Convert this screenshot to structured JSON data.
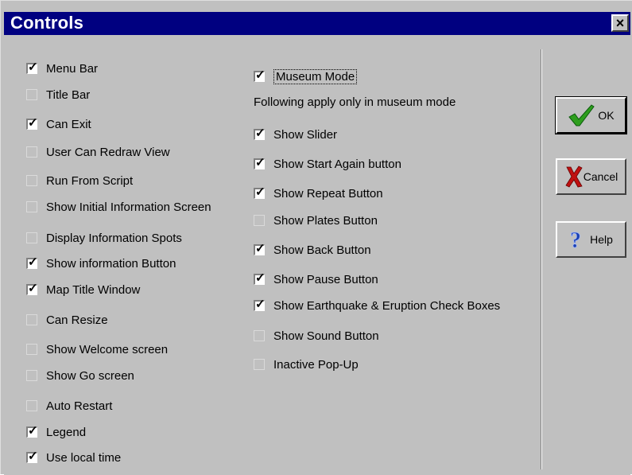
{
  "window": {
    "title": "Controls",
    "close_glyph": "×"
  },
  "left_options": [
    {
      "label": "Menu Bar",
      "checked": true
    },
    {
      "label": "Title Bar",
      "checked": false
    },
    {
      "label": "Can Exit",
      "checked": true
    },
    {
      "label": "User Can Redraw View",
      "checked": false
    },
    {
      "label": "Run From Script",
      "checked": false
    },
    {
      "label": "Show Initial Information Screen",
      "checked": false
    },
    {
      "label": "Display Information Spots",
      "checked": false
    },
    {
      "label": "Show information Button",
      "checked": true
    },
    {
      "label": "Map Title Window",
      "checked": true
    },
    {
      "label": "Can Resize",
      "checked": false
    },
    {
      "label": "Show Welcome screen",
      "checked": false
    },
    {
      "label": "Show Go screen",
      "checked": false
    },
    {
      "label": "Auto Restart",
      "checked": false
    },
    {
      "label": "Legend",
      "checked": true
    },
    {
      "label": "Use local time",
      "checked": true
    }
  ],
  "museum_mode": {
    "label": "Museum Mode",
    "checked": true
  },
  "museum_note": "Following apply only in museum mode",
  "right_options": [
    {
      "label": "Show Slider",
      "checked": true
    },
    {
      "label": "Show Start Again button",
      "checked": true
    },
    {
      "label": "Show Repeat Button",
      "checked": true
    },
    {
      "label": "Show Plates Button",
      "checked": false
    },
    {
      "label": "Show Back Button",
      "checked": true
    },
    {
      "label": "Show Pause Button",
      "checked": true
    },
    {
      "label": "Show Earthquake & Eruption Check Boxes",
      "checked": true
    },
    {
      "label": "Show Sound Button",
      "checked": false
    },
    {
      "label": "Inactive Pop-Up",
      "checked": false
    }
  ],
  "buttons": {
    "ok": {
      "label": "OK",
      "icon": "green-checkmark-icon",
      "color": "#2e9e1e"
    },
    "cancel": {
      "label": "Cancel",
      "icon": "red-x-icon",
      "color": "#c01010"
    },
    "help": {
      "label": "Help",
      "icon": "question-mark-icon",
      "color": "#1a3fb0"
    }
  }
}
